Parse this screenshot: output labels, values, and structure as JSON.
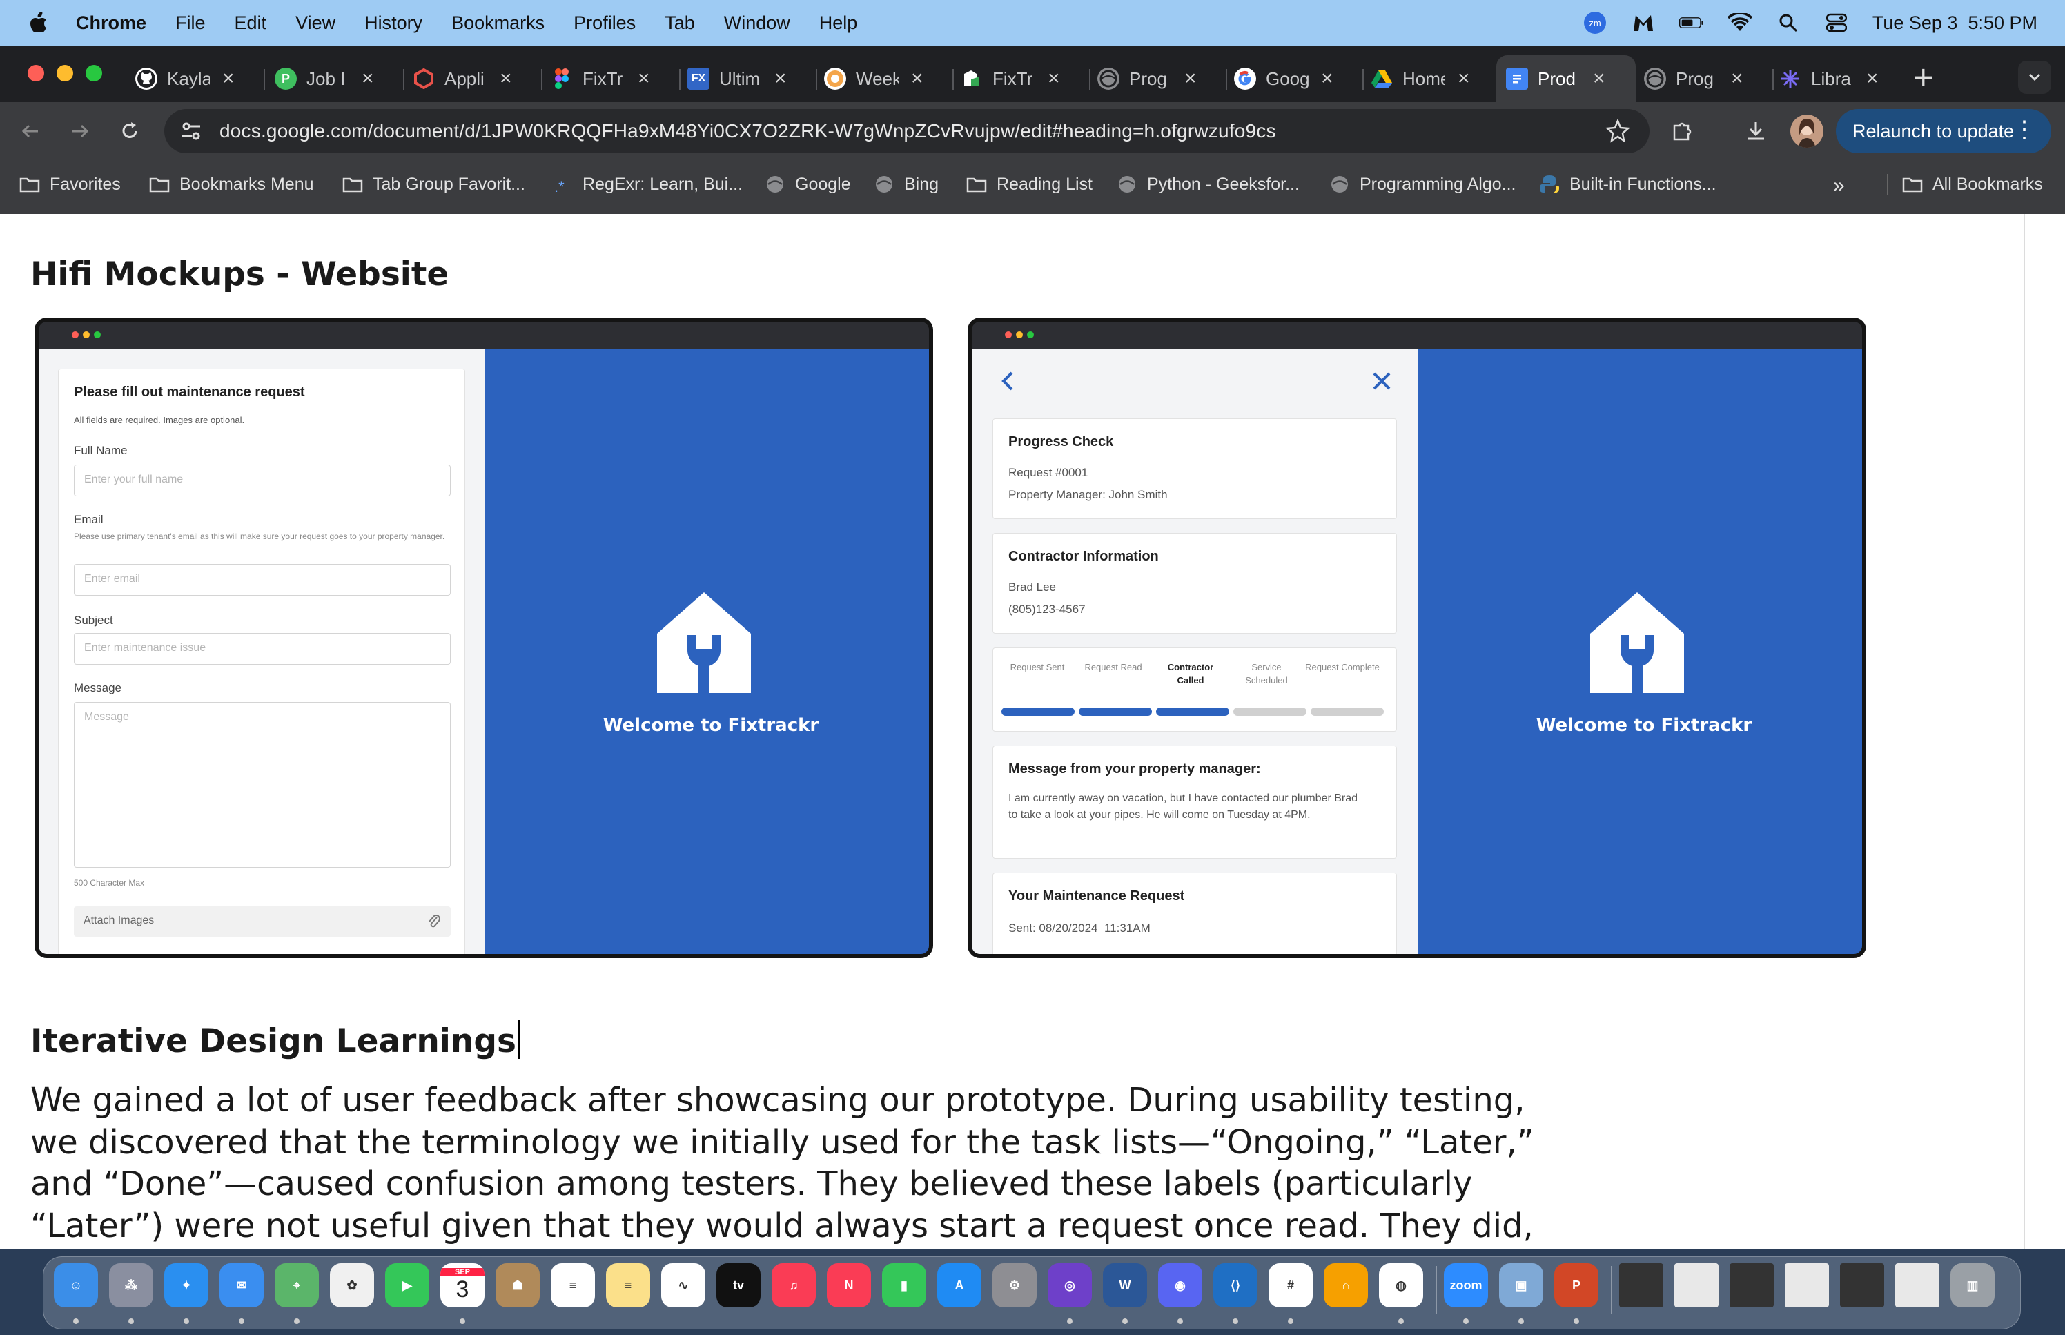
{
  "menubar": {
    "app": "Chrome",
    "items": [
      "File",
      "Edit",
      "View",
      "History",
      "Bookmarks",
      "Profiles",
      "Tab",
      "Window",
      "Help"
    ],
    "clock": "Tue Sep 3  5:50 PM"
  },
  "tabs": [
    {
      "title": "Kayla",
      "icon": "github-icon"
    },
    {
      "title": "Job I",
      "icon": "jobright-icon"
    },
    {
      "title": "Appli",
      "icon": "gem-icon"
    },
    {
      "title": "FixTr",
      "icon": "figma-icon"
    },
    {
      "title": "Ultim",
      "icon": "fx-icon"
    },
    {
      "title": "Week",
      "icon": "record-icon"
    },
    {
      "title": "FixTr",
      "icon": "drive-file-icon"
    },
    {
      "title": "Prog",
      "icon": "globe-icon"
    },
    {
      "title": "Goog",
      "icon": "google-icon"
    },
    {
      "title": "Home",
      "icon": "drive-icon"
    },
    {
      "title": "Prod",
      "icon": "docs-icon",
      "active": true
    },
    {
      "title": "Prog",
      "icon": "globe-icon"
    },
    {
      "title": "Libra",
      "icon": "library-icon"
    }
  ],
  "omnibox": {
    "url": "docs.google.com/document/d/1JPW0KRQQFHa9xM48Yi0CX7O2ZRK-W7gWnpZCvRvujpw/edit#heading=h.ofgrwzufo9cs"
  },
  "relaunch": {
    "label": "Relaunch to update"
  },
  "bookmarks": {
    "items": [
      {
        "label": "Favorites",
        "icon": "folder-icon"
      },
      {
        "label": "Bookmarks Menu",
        "icon": "folder-icon"
      },
      {
        "label": "Tab Group Favorit...",
        "icon": "folder-icon"
      },
      {
        "label": "RegExr: Learn, Bui...",
        "icon": "regexr-icon"
      },
      {
        "label": "Google",
        "icon": "globe-icon"
      },
      {
        "label": "Bing",
        "icon": "globe-icon"
      },
      {
        "label": "Reading List",
        "icon": "folder-icon"
      },
      {
        "label": "Python - Geeksfor...",
        "icon": "globe-icon"
      },
      {
        "label": "Programming Algo...",
        "icon": "globe-icon"
      },
      {
        "label": "Built-in Functions...",
        "icon": "python-icon"
      }
    ],
    "all": "All Bookmarks"
  },
  "doc": {
    "heading1": "Hifi Mockups - Website",
    "heading2": "Iterative Design Learnings",
    "paragraph": "We gained a lot of user feedback after showcasing our prototype. During usability testing, we discovered that the terminology we initially used for the task lists—“Ongoing,” “Later,” and “Done”—caused confusion among testers. They believed these labels (particularly “Later”) were not useful given that they would always start a request once read. They did,"
  },
  "mockup1": {
    "form_title": "Please fill out maintenance request",
    "form_subtitle": "All fields are required. Images are optional.",
    "full_name_label": "Full Name",
    "full_name_placeholder": "Enter your full name",
    "email_label": "Email",
    "email_hint": "Please use primary tenant's email as this will make sure your request goes to your property manager.",
    "email_placeholder": "Enter email",
    "subject_label": "Subject",
    "subject_placeholder": "Enter maintenance issue",
    "message_label": "Message",
    "message_placeholder": "Message",
    "char_max": "500 Character Max",
    "attach_label": "Attach Images",
    "welcome": "Welcome to Fixtrackr"
  },
  "mockup2": {
    "progress_title": "Progress Check",
    "request_id": "Request #0001",
    "property_manager": "Property Manager: John Smith",
    "contractor_title": "Contractor Information",
    "contractor_name": "Brad Lee",
    "contractor_phone": "(805)123-4567",
    "steps": [
      {
        "label": "Request Sent",
        "done": true
      },
      {
        "label": "Request Read",
        "done": true
      },
      {
        "label": "Contractor Called",
        "done": true
      },
      {
        "label": "Service Scheduled",
        "done": false
      },
      {
        "label": "Request Complete",
        "done": false
      }
    ],
    "message_title": "Message from your property manager:",
    "message_body": "I am currently away on vacation, but I have contacted our plumber Brad to take a look at your pipes. He will come on Tuesday at 4PM.",
    "request_title": "Your Maintenance Request",
    "request_sent": "Sent: 08/20/2024  11:31AM",
    "welcome": "Welcome to Fixtrackr"
  },
  "colors": {
    "brand_blue": "#2c62be",
    "progress_done": "#2c62be",
    "progress_todo": "#d0d0d0",
    "menubar": "#9ecbf3"
  },
  "dock": {
    "calendar_month": "SEP",
    "calendar_day": "3",
    "apps": [
      "finder-icon",
      "launchpad-icon",
      "safari-icon",
      "mail-icon",
      "maps-icon",
      "photos-icon",
      "facetime-icon",
      "calendar-icon",
      "contacts-icon",
      "reminders-icon",
      "notes-icon",
      "freeform-icon",
      "apple-tv-icon",
      "music-icon",
      "news-icon",
      "numbers-icon",
      "app-store-icon",
      "system-settings-icon",
      "github-desktop-icon",
      "word-icon",
      "discord-icon",
      "vscode-icon",
      "slack-icon",
      "sourcetree-icon",
      "chrome-icon",
      "zoom-icon",
      "preview-icon",
      "powerpoint-icon",
      "trash-icon"
    ]
  }
}
